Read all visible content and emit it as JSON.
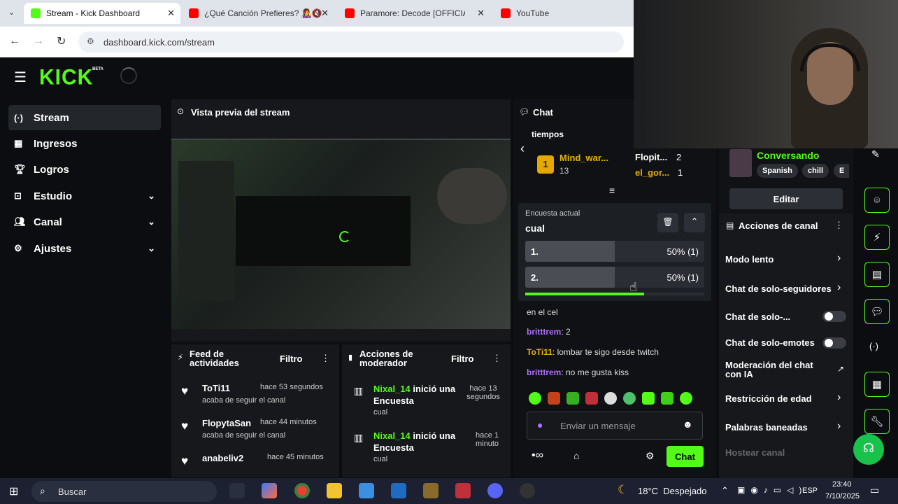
{
  "browser": {
    "tabs": [
      {
        "label": "Stream - Kick Dashboard",
        "active": true
      },
      {
        "label": "¿Qué Canción Prefieres? 👩‍🎤🔇",
        "active": false
      },
      {
        "label": "Paramore: Decode [OFFICIAL VI",
        "active": false
      },
      {
        "label": "YouTube",
        "active": false
      }
    ],
    "url": "dashboard.kick.com/stream"
  },
  "app": {
    "logo": "KICK",
    "beta": "BETA"
  },
  "sidebar": {
    "items": [
      {
        "label": "Stream",
        "icon": "stream-icon"
      },
      {
        "label": "Ingresos",
        "icon": "ingresos-icon"
      },
      {
        "label": "Logros",
        "icon": "trophy-icon"
      },
      {
        "label": "Estudio",
        "icon": "estudio-icon"
      },
      {
        "label": "Canal",
        "icon": "canal-icon"
      },
      {
        "label": "Ajustes",
        "icon": "gear-icon"
      }
    ]
  },
  "preview": {
    "title": "Vista previa del stream"
  },
  "feed": {
    "title": "Feed de actividades",
    "filter": "Filtro",
    "items": [
      {
        "name": "ToTi11",
        "time": "hace 53 segundos",
        "desc": "acaba de seguir el canal"
      },
      {
        "name": "FlopytaSan",
        "time": "hace 44 minutos",
        "desc": "acaba de seguir el canal"
      },
      {
        "name": "anabeliv2",
        "time": "hace 45 minutos",
        "desc": ""
      }
    ]
  },
  "mod": {
    "title": "Acciones de moderador",
    "filter": "Filtro",
    "items": [
      {
        "name": "Nixal_14",
        "action": "inició una Encuesta",
        "time": "hace 13 segundos",
        "sub": "cual"
      },
      {
        "name": "Nixal_14",
        "action": "inició una Encuesta",
        "time": "hace 1 minuto",
        "sub": "cual"
      }
    ]
  },
  "chat": {
    "title": "Chat",
    "top_text": "tiempos",
    "leaders": {
      "first": {
        "rank": "1",
        "name": "Mind_war...",
        "count": "13"
      },
      "others": [
        {
          "name": "Flopit...",
          "count": "2"
        },
        {
          "name": "el_gor...",
          "count": "1"
        }
      ]
    },
    "poll": {
      "label": "Encuesta actual",
      "question": "cual",
      "options": [
        {
          "label": "1.",
          "result": "50% (1)",
          "pct": 50
        },
        {
          "label": "2.",
          "result": "50% (1)",
          "pct": 50
        }
      ]
    },
    "messages": [
      {
        "user": "",
        "text": "en el cel"
      },
      {
        "user": "britttrem",
        "text": ": 2"
      },
      {
        "user": "ToTi11",
        "text": ": lombar te sigo desde twitch"
      },
      {
        "user": "britttrem",
        "text": ": no me gusta kiss"
      }
    ],
    "input_placeholder": "Enviar un mensaje",
    "send_label": "Chat"
  },
  "channel": {
    "status": "Conversando",
    "tags": [
      "Spanish",
      "chill",
      "E"
    ],
    "edit_label": "Editar",
    "actions_title": "Acciones de canal",
    "actions": [
      {
        "label": "Modo lento",
        "type": "chevron"
      },
      {
        "label": "Chat de solo-seguidores",
        "type": "chevron"
      },
      {
        "label": "Chat de solo-...",
        "type": "toggle"
      },
      {
        "label": "Chat de solo-emotes",
        "type": "toggle"
      },
      {
        "label": "Moderación del chat con IA",
        "type": "external"
      },
      {
        "label": "Restricción de edad",
        "type": "chevron"
      },
      {
        "label": "Palabras baneadas",
        "type": "chevron"
      },
      {
        "label": "Hostear canal",
        "type": "disabled"
      }
    ]
  },
  "taskbar": {
    "search": "Buscar",
    "weather": "18°C  Despejado",
    "lang": "ESP",
    "time": "23:40",
    "date": "7/10/2025"
  },
  "colors": {
    "accent": "#53fc18",
    "bg": "#0b0d10",
    "panel": "#16181c"
  }
}
